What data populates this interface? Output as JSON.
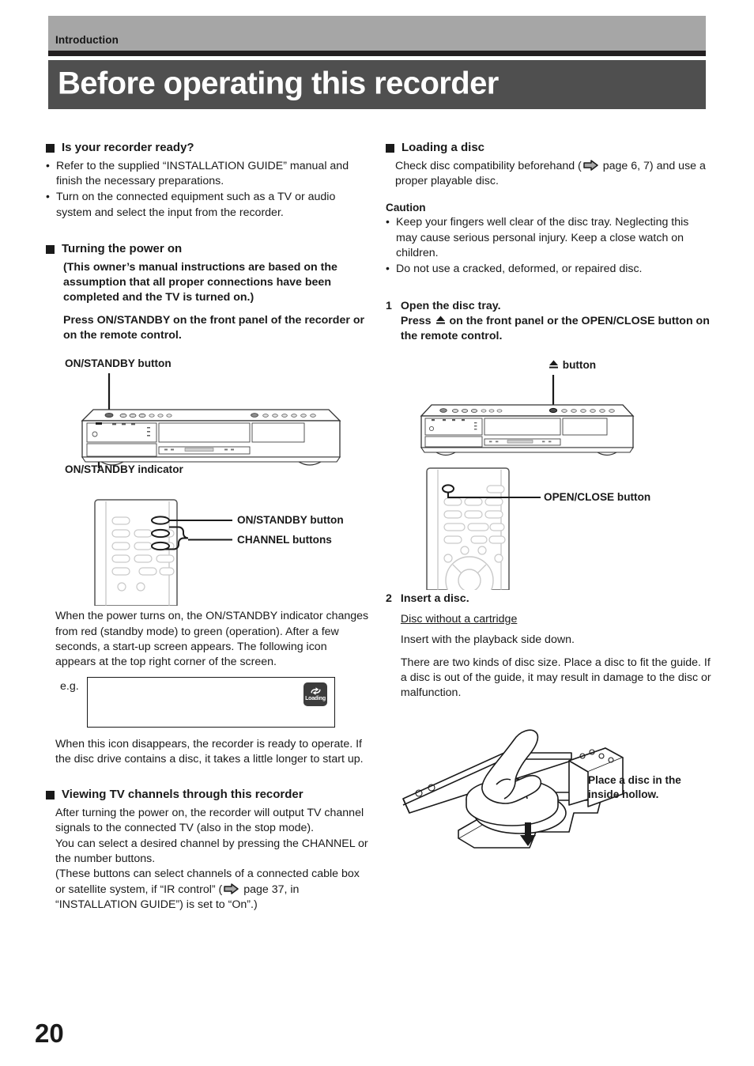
{
  "header": {
    "section_label": "Introduction",
    "title": "Before operating this recorder"
  },
  "page_number": "20",
  "colors": {
    "header_band": "#a6a6a6",
    "title_band": "#4f4f4f",
    "rule": "#231f20",
    "text": "#1a1a1a",
    "arrow_fill": "#a8a8a8",
    "loading_icon_bg": "#3c3c3c"
  },
  "left_column": {
    "section_ready": {
      "heading": "Is your recorder ready?",
      "bullets": [
        "Refer to the supplied “INSTALLATION GUIDE” manual and finish the necessary preparations.",
        "Turn on the connected equipment such as a TV or audio system and select the input from the recorder."
      ]
    },
    "section_power": {
      "heading": "Turning the power on",
      "paragraph_1": "(This owner’s manual instructions are based on the assumption that all proper connections have been completed and the TV is turned on.)",
      "paragraph_2": "Press ON/STANDBY on the front panel of the recorder or on the remote control."
    },
    "front_panel_figure": {
      "label_button": "ON/STANDBY button",
      "label_indicator": "ON/STANDBY indicator"
    },
    "remote_figure": {
      "label_onstandby": "ON/STANDBY button",
      "label_channel": "CHANNEL buttons"
    },
    "paragraph_after_remote": "When the power turns on, the ON/STANDBY indicator changes from red (standby mode) to green (operation). After a few seconds, a start-up screen appears. The following icon appears at the top right corner of the screen.",
    "example": {
      "label": "e.g.",
      "icon_text": "Loading"
    },
    "paragraph_after_example": "When this icon disappears, the recorder is ready to operate.  If the disc drive contains a disc, it takes a little longer to start up.",
    "section_viewing": {
      "heading": "Viewing TV channels through this recorder",
      "paragraph_1": "After turning the power on, the recorder will output TV channel signals to the connected TV (also in the stop mode).",
      "paragraph_2": "You can select a desired channel by pressing the CHANNEL or the number buttons.",
      "paragraph_3_a": "(These buttons can select channels of a connected cable box or satellite system, if “IR control” (",
      "paragraph_3_b": " page 37, in “INSTALLATION GUIDE”) is set to “On”.)"
    }
  },
  "right_column": {
    "section_loading": {
      "heading": "Loading a disc",
      "paragraph_a": "Check disc compatibility beforehand (",
      "paragraph_b": " page 6, 7) and use a proper playable disc."
    },
    "caution": {
      "heading": "Caution",
      "bullets": [
        "Keep your fingers well clear of the disc tray. Neglecting this may cause serious personal injury.  Keep a close watch on children.",
        "Do not use a cracked, deformed, or repaired disc."
      ]
    },
    "step_1": {
      "number": "1",
      "title": "Open the disc tray.",
      "instruction_a": "Press ",
      "instruction_b": " on the front panel or the OPEN/CLOSE button on the remote control."
    },
    "front_panel_figure": {
      "label_eject": " button"
    },
    "remote_figure": {
      "label_openclose": "OPEN/CLOSE button"
    },
    "step_2": {
      "number": "2",
      "title": "Insert a disc.",
      "subtitle": "Disc without a cartridge",
      "paragraph_1": "Insert with the playback side down.",
      "paragraph_2": "There are two kinds of disc size. Place a disc to fit the guide. If a disc is out of the guide, it may result in damage to the disc or malfunction."
    },
    "disc_figure": {
      "caption": "Place a disc in the\ninside hollow."
    }
  }
}
